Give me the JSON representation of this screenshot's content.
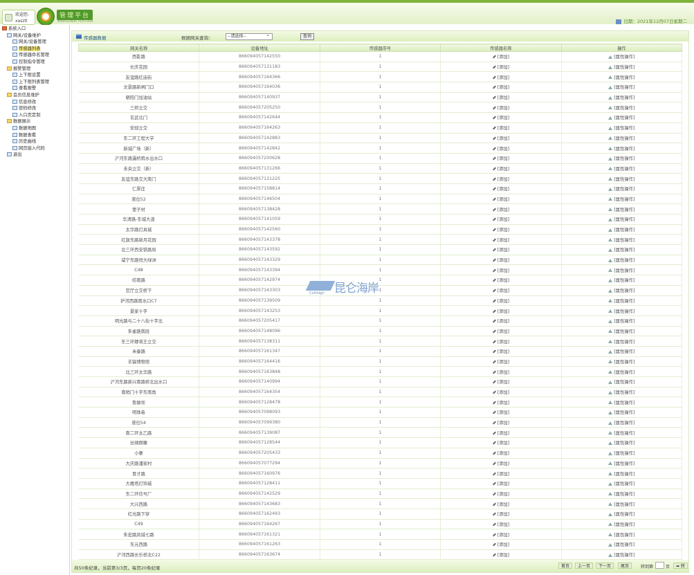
{
  "header": {
    "welcome": "欢迎您-",
    "user": "xasztl",
    "brand": "管理平台",
    "brand_sub": "MANAGEMENT PLATFORM",
    "date": "日期：2021年12月07日星期二"
  },
  "sidebar": {
    "items": [
      {
        "label": "系统入口",
        "level": 0,
        "icon": "home"
      },
      {
        "label": "网关/设备维护",
        "level": 1,
        "icon": "network"
      },
      {
        "label": "网关/设备管理",
        "level": 2,
        "icon": "page"
      },
      {
        "label": "传感器列表",
        "level": 2,
        "icon": "page",
        "selected": true
      },
      {
        "label": "传感器命名管理",
        "level": 2,
        "icon": "page"
      },
      {
        "label": "控制指令管理",
        "level": 2,
        "icon": "page"
      },
      {
        "label": "报警管理",
        "level": 1,
        "icon": "folder"
      },
      {
        "label": "上下限设置",
        "level": 2,
        "icon": "page"
      },
      {
        "label": "上下限列表管理",
        "level": 2,
        "icon": "page"
      },
      {
        "label": "查看报警",
        "level": 2,
        "icon": "page"
      },
      {
        "label": "会员信息维护",
        "level": 1,
        "icon": "folder"
      },
      {
        "label": "信息修改",
        "level": 2,
        "icon": "edit"
      },
      {
        "label": "密码修改",
        "level": 2,
        "icon": "key"
      },
      {
        "label": "入口页定制",
        "level": 2,
        "icon": "page"
      },
      {
        "label": "数据展示",
        "level": 1,
        "icon": "folder"
      },
      {
        "label": "数据地图",
        "level": 2,
        "icon": "page"
      },
      {
        "label": "数据查看",
        "level": 2,
        "icon": "page"
      },
      {
        "label": "历史曲线",
        "level": 2,
        "icon": "chart"
      },
      {
        "label": "网页嵌入代码",
        "level": 2,
        "icon": "page"
      },
      {
        "label": "退出",
        "level": 1,
        "icon": "page"
      }
    ]
  },
  "panel": {
    "title": "传感器数据",
    "query_label": "根据网关查询：",
    "select_value": "--请选择--",
    "query_button": "查询"
  },
  "table": {
    "headers": [
      "网关名称",
      "设备地址",
      "传感器序号",
      "传感器名称",
      "操作"
    ],
    "add_label": "[添加]",
    "op_label": "[属性操作]",
    "rows": [
      [
        "西影路",
        "866094057142550",
        "1"
      ],
      [
        "长庆花园",
        "866094057131183",
        "1"
      ],
      [
        "友谊路红庙街",
        "866094057164366",
        "1"
      ],
      [
        "文景路新闸门口",
        "866094057164036",
        "1"
      ],
      [
        "朝阳门加油站",
        "866094057140937",
        "1"
      ],
      [
        "三桥立交",
        "866094057205250",
        "1"
      ],
      [
        "玄武北门",
        "866094057142644",
        "1"
      ],
      [
        "安邸立交",
        "866094057164263",
        "1"
      ],
      [
        "东二环工程大学",
        "866094057142883",
        "1"
      ],
      [
        "新城广场（新）",
        "866094057142842",
        "1"
      ],
      [
        "浐河东路灞桥雨水出水口",
        "866094057200628",
        "1"
      ],
      [
        "未央立交（新）",
        "866094057131266",
        "1"
      ],
      [
        "友谊东路交大南门",
        "866094057131225",
        "1"
      ],
      [
        "仁厚庄",
        "866094057158814",
        "1"
      ],
      [
        "液位52",
        "866094057146504",
        "1"
      ],
      [
        "堡子村",
        "866094057138428",
        "1"
      ],
      [
        "华清路-东城大道",
        "866094057141059",
        "1"
      ],
      [
        "太华路灯具城",
        "866094057142560",
        "1"
      ],
      [
        "红旗东路新月花园",
        "866094057143378",
        "1"
      ],
      [
        "北三环西安铁路局",
        "866094057143592",
        "1"
      ],
      [
        "咸宁东路恒大绿洲",
        "866094057143329",
        "1"
      ],
      [
        "C48",
        "866094057143394",
        "1"
      ],
      [
        "纺南路",
        "866094057142974",
        "1"
      ],
      [
        "官厅立交桥下",
        "866094057143303",
        "1"
      ],
      [
        "护河西路雨水口C7",
        "866094057139509",
        "1"
      ],
      [
        "景家十字",
        "866094057143253",
        "1"
      ],
      [
        "明光路与二十八街十字北",
        "866094057205417",
        "1"
      ],
      [
        "朱雀路南段",
        "866094057148096",
        "1"
      ],
      [
        "东三环穆将王立交",
        "866094057138311",
        "1"
      ],
      [
        "米秦路",
        "866094057161347",
        "1"
      ],
      [
        "丰镐博物馆",
        "866094057164416",
        "1"
      ],
      [
        "北三环太华路",
        "866094057163848",
        "1"
      ],
      [
        "浐河东路新兴南路桥北出水口",
        "866094057140994",
        "1"
      ],
      [
        "南稍门十字东南角",
        "866094057164354",
        "1"
      ],
      [
        "詹塬坝",
        "866094057128478",
        "1"
      ],
      [
        "明珠巷",
        "866094057098093",
        "1"
      ],
      [
        "液位54",
        "866094057099380",
        "1"
      ],
      [
        "南二环太乙路",
        "866094057139087",
        "1"
      ],
      [
        "丝绸群雕",
        "866094057128544",
        "1"
      ],
      [
        "小寨",
        "866094057205433",
        "1"
      ],
      [
        "大庆路潘家村",
        "866094057077294",
        "1"
      ],
      [
        "育才路",
        "866094057160976",
        "1"
      ],
      [
        "大雁塔灯饰城",
        "866094057128411",
        "1"
      ],
      [
        "东二环信号厂",
        "866094057142529",
        "1"
      ],
      [
        "大兴西路",
        "866094057143683",
        "1"
      ],
      [
        "红光路下穿",
        "866094057162493",
        "1"
      ],
      [
        "C49",
        "866094057164267",
        "1"
      ],
      [
        "朱宏路凤城七路",
        "866094057161321",
        "1"
      ],
      [
        "东元西路",
        "866094057161263",
        "1"
      ],
      [
        "浐河西路长乐桥北C22",
        "866094057163674",
        "1"
      ]
    ]
  },
  "footer": {
    "info": "共50条纪录，当前第3/3页，每页20条纪录",
    "first": "首页",
    "prev": "上一页",
    "next": "下一页",
    "last": "尾页",
    "goto_label": "转到第",
    "goto_value": "",
    "goto_page": "页",
    "go": "➡ 转"
  },
  "watermark": {
    "text": "昆仑海岸",
    "en": "Collihigh"
  }
}
